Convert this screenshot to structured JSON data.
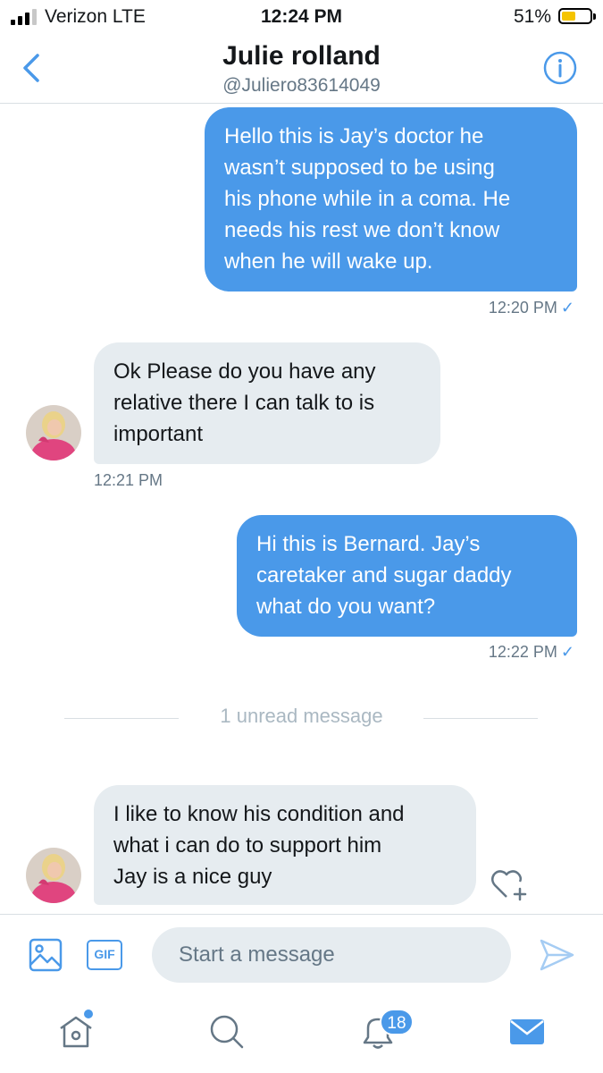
{
  "status_bar": {
    "carrier": "Verizon  LTE",
    "time": "12:24 PM",
    "battery_percent": "51%",
    "battery_level": 0.51,
    "signal_bars": 3
  },
  "header": {
    "name": "Julie rolland",
    "handle": "@Juliero83614049",
    "back_icon": "chevron-left-icon",
    "info_icon": "info-icon"
  },
  "messages": [
    {
      "direction": "outgoing",
      "lines": [
        "Hello this is Jay’s doctor he",
        "wasn’t supposed to be using",
        "his phone while in a coma. He",
        "needs his rest we don’t know",
        "when he will wake up."
      ],
      "time": "12:20 PM",
      "check": "✓"
    },
    {
      "direction": "incoming",
      "lines": [
        "Ok Please do you have any",
        "relative there I can talk to is",
        "important"
      ],
      "time": "12:21 PM"
    },
    {
      "direction": "outgoing",
      "lines": [
        "Hi this is Bernard. Jay’s",
        "caretaker and sugar daddy",
        "what do you want?"
      ],
      "time": "12:22 PM",
      "check": "✓"
    },
    {
      "direction": "incoming",
      "lines": [
        "I like to know his condition and",
        "what i can do to support him",
        "Jay is a nice guy"
      ]
    }
  ],
  "unread_divider": "1 unread message",
  "composer": {
    "placeholder": "Start a message",
    "gif_label": "GIF"
  },
  "tab_bar": {
    "notifications_badge": "18",
    "tabs": [
      "home-icon",
      "search-icon",
      "notifications-icon",
      "messages-icon"
    ]
  },
  "colors": {
    "accent": "#4a99e9",
    "incoming_bubble": "#e6ecf0",
    "secondary_text": "#657786",
    "battery": "#f5c400"
  }
}
